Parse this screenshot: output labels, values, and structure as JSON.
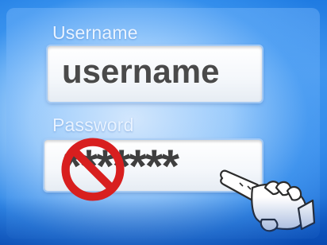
{
  "login": {
    "username_label": "Username",
    "username_value": "username",
    "password_label": "Password",
    "password_value": "*******"
  },
  "icons": {
    "prohibition": "no-entry-sign",
    "cursor": "pointing-hand-cursor"
  },
  "colors": {
    "background_blue": "#0a5fc8",
    "prohibition_red": "#d81f1f"
  }
}
